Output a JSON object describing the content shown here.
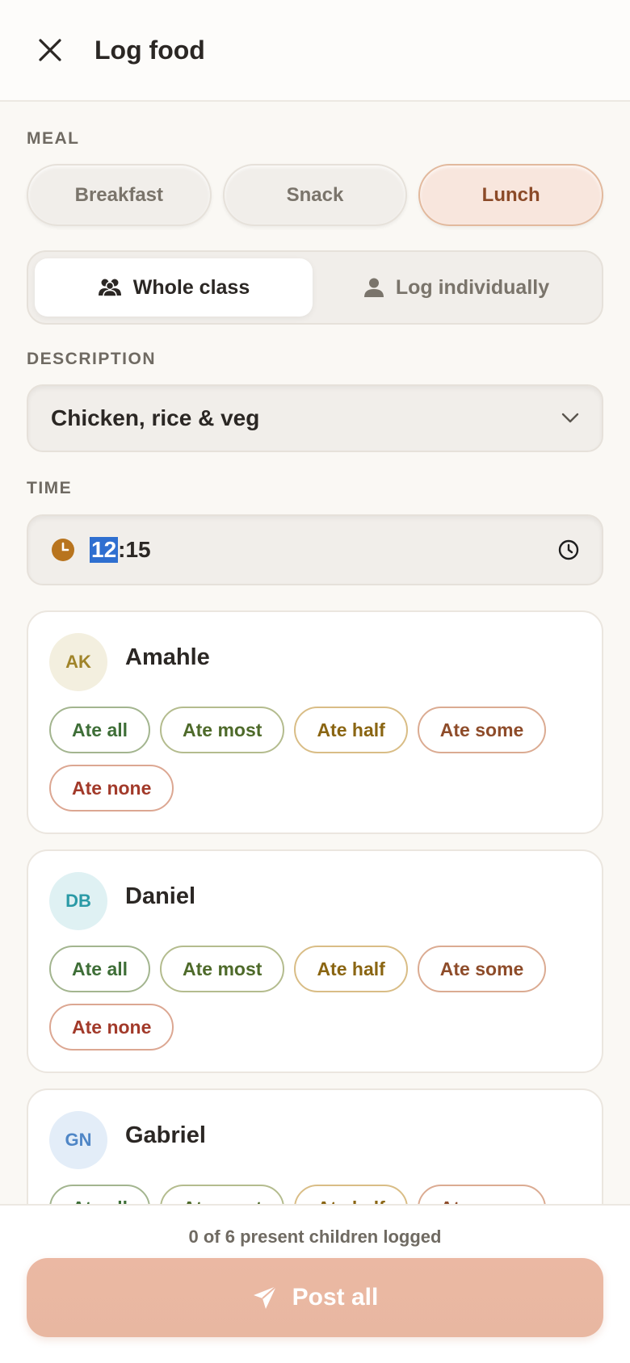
{
  "header": {
    "title": "Log food",
    "close_icon": "close-icon"
  },
  "meal": {
    "label": "MEAL",
    "options": [
      "Breakfast",
      "Snack",
      "Lunch"
    ],
    "selected": "Lunch"
  },
  "mode": {
    "options": [
      {
        "label": "Whole class",
        "icon": "group-icon",
        "active": true
      },
      {
        "label": "Log individually",
        "icon": "person-icon",
        "active": false
      }
    ]
  },
  "description": {
    "label": "DESCRIPTION",
    "value": "Chicken, rice & veg"
  },
  "time": {
    "label": "TIME",
    "hours": "12",
    "separator": ":",
    "minutes": "15"
  },
  "children": [
    {
      "initials": "AK",
      "name": "Amahle",
      "avatar_bg": "#f3efdf",
      "avatar_fg": "#a0842a"
    },
    {
      "initials": "DB",
      "name": "Daniel",
      "avatar_bg": "#dff1f3",
      "avatar_fg": "#2a9aa6"
    },
    {
      "initials": "GN",
      "name": "Gabriel",
      "avatar_bg": "#e3edf8",
      "avatar_fg": "#4f86c6"
    }
  ],
  "portions": [
    "Ate all",
    "Ate most",
    "Ate half",
    "Ate some",
    "Ate none"
  ],
  "footer": {
    "status": "0 of 6 present children logged",
    "post_label": "Post all"
  },
  "colors": {
    "accent": "#e8b7a1",
    "background": "#faf8f4"
  }
}
